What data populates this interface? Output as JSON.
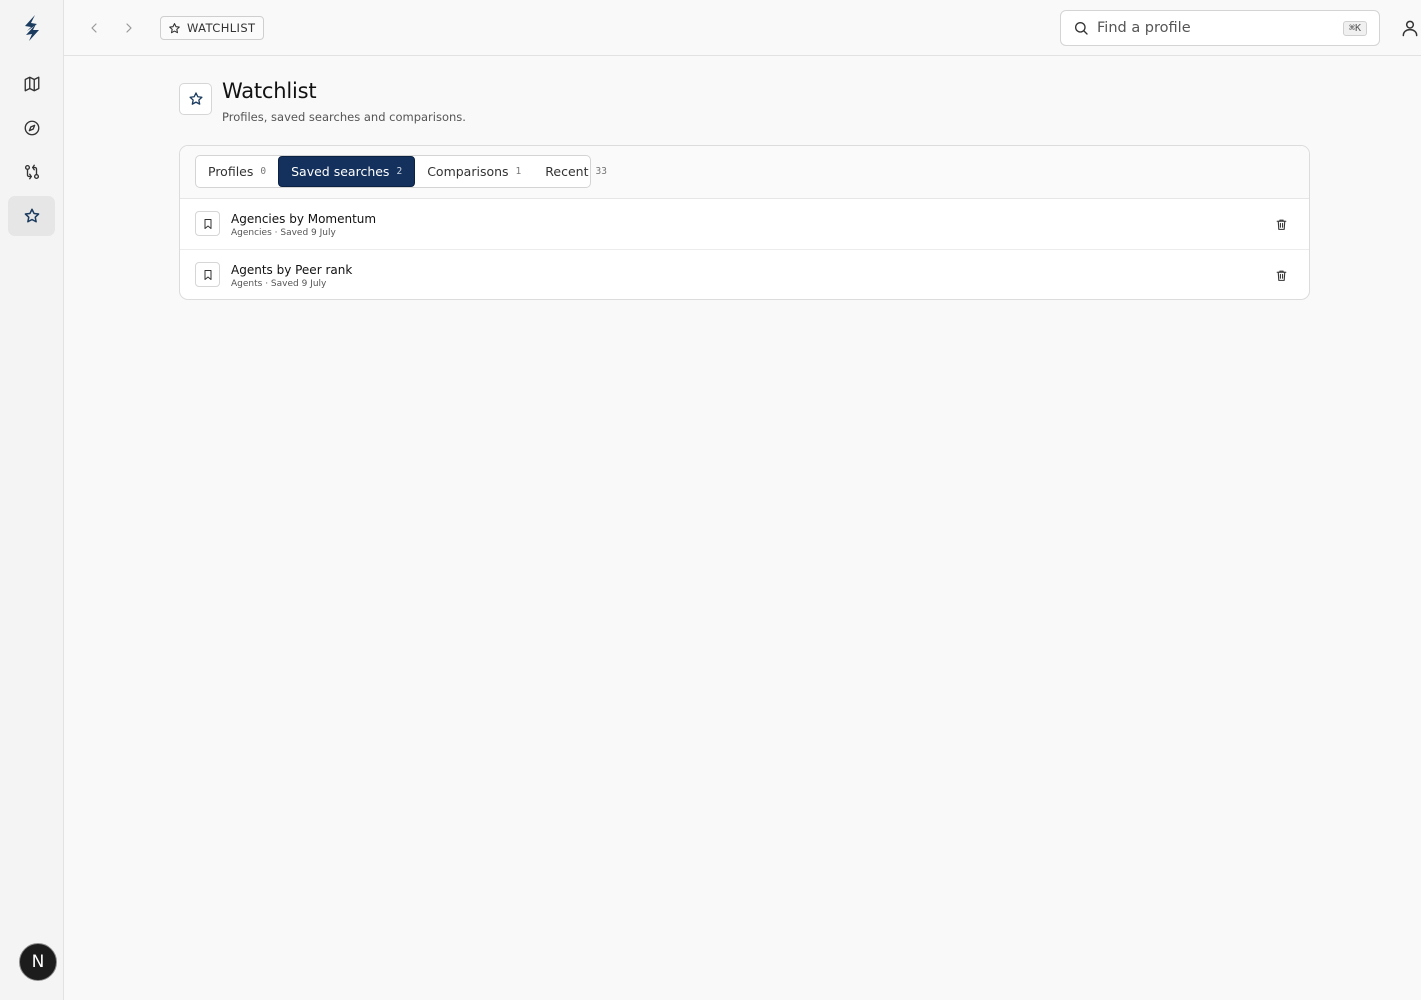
{
  "app": {
    "brand_icon": "lightning-s-logo-icon",
    "colors": {
      "accent": "#13315c",
      "sidebar_bg": "#f4f4f4",
      "page_bg": "#f9f9f9"
    }
  },
  "sidebar": {
    "items": [
      {
        "name": "map",
        "icon": "map-icon",
        "active": false
      },
      {
        "name": "explore",
        "icon": "compass-icon",
        "active": false
      },
      {
        "name": "compare",
        "icon": "git-compare-icon",
        "active": false
      },
      {
        "name": "watchlist",
        "icon": "star-icon",
        "active": true
      }
    ],
    "avatar_initial": "N"
  },
  "topbar": {
    "breadcrumb": "WATCHLIST",
    "search_placeholder": "Find a profile",
    "search_shortcut": "⌘K"
  },
  "header": {
    "title": "Watchlist",
    "subtitle": "Profiles, saved searches and comparisons."
  },
  "tabs": [
    {
      "label": "Profiles",
      "count": "0",
      "active": false
    },
    {
      "label": "Saved searches",
      "count": "2",
      "active": true
    },
    {
      "label": "Comparisons",
      "count": "1",
      "active": false
    },
    {
      "label": "Recent",
      "count": "33",
      "active": false
    }
  ],
  "saved_searches": [
    {
      "title": "Agencies by Momentum",
      "meta": "Agencies · Saved 9 July"
    },
    {
      "title": "Agents by Peer rank",
      "meta": "Agents · Saved 9 July"
    }
  ]
}
